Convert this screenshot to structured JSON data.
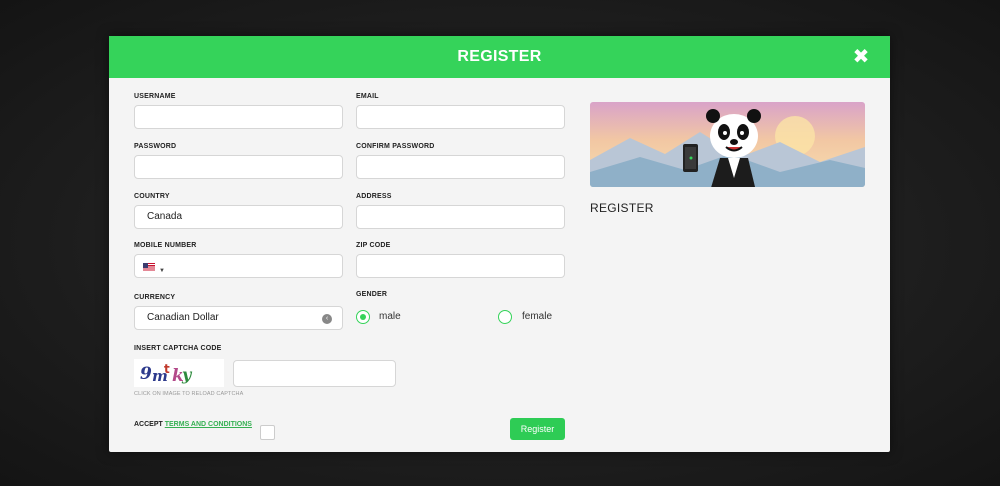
{
  "modal": {
    "title": "REGISTER",
    "close_glyph": "✖"
  },
  "form": {
    "username": {
      "label": "USERNAME",
      "value": ""
    },
    "email": {
      "label": "EMAIL",
      "value": ""
    },
    "password": {
      "label": "PASSWORD",
      "value": ""
    },
    "confirm_password": {
      "label": "CONFIRM PASSWORD",
      "value": ""
    },
    "country": {
      "label": "COUNTRY",
      "value": "Canada"
    },
    "address": {
      "label": "ADDRESS",
      "value": ""
    },
    "mobile": {
      "label": "MOBILE NUMBER",
      "value": "",
      "flag_icon": "us-flag-icon"
    },
    "zip": {
      "label": "ZIP CODE",
      "value": ""
    },
    "currency": {
      "label": "CURRENCY",
      "value": "Canadian Dollar",
      "arrow_glyph": "‹"
    },
    "gender": {
      "label": "GENDER",
      "options": [
        "male",
        "female"
      ],
      "selected": "male"
    },
    "captcha": {
      "label": "INSERT CAPTCHA CODE",
      "image_text": "9m ky",
      "hint": "CLICK ON IMAGE TO RELOAD CAPTCHA",
      "value": ""
    },
    "accept": {
      "prefix": "ACCEPT ",
      "link": "TERMS AND CONDITIONS"
    },
    "submit_label": "Register"
  },
  "side": {
    "title": "REGISTER"
  },
  "colors": {
    "accent": "#35d35a",
    "button": "#2ecc55"
  }
}
